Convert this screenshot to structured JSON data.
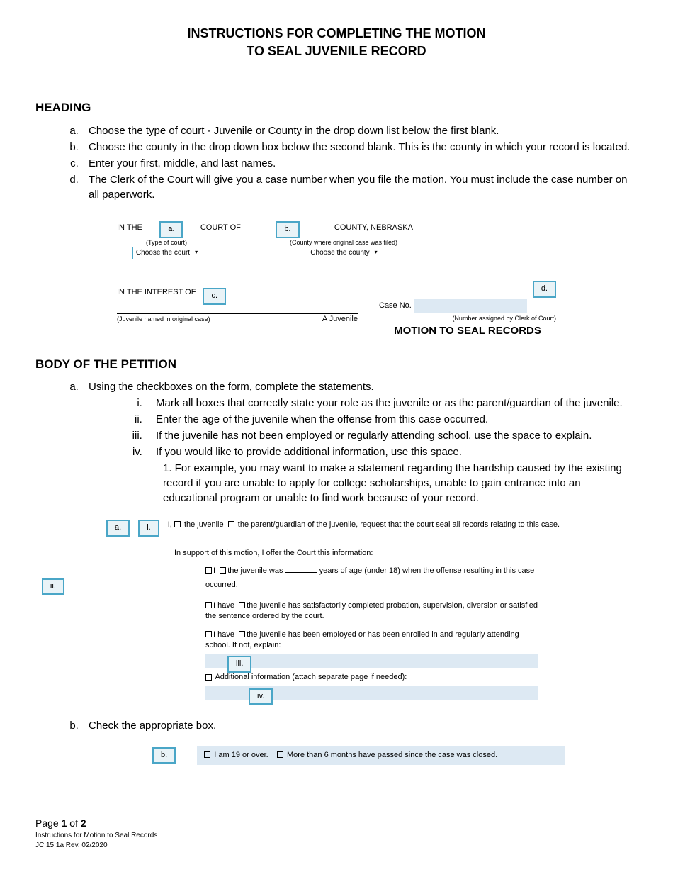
{
  "title_line1": "INSTRUCTIONS FOR COMPLETING THE MOTION",
  "title_line2": "TO SEAL JUVENILE RECORD",
  "heading_section": "HEADING",
  "heading_items": {
    "a": "Choose the type of court - Juvenile or County in the drop down list below the first blank.",
    "b": "Choose the county in the drop down box below the second blank. This is the county in which your record is located.",
    "c": "Enter your first, middle, and last names.",
    "d": "The Clerk of the Court will give you a case number when you file the motion. You must include the case number on all paperwork."
  },
  "form1": {
    "in_the": "IN THE",
    "a": "a.",
    "court_of": "COURT OF",
    "b": "b.",
    "county_ne": "COUNTY, NEBRASKA",
    "type_of_court": "(Type of court)",
    "county_filed": "(County where original case was filed)",
    "choose_court": "Choose the court",
    "choose_county": "Choose the county",
    "in_interest": "IN THE INTEREST OF",
    "c": "c.",
    "juv_named": "(Juvenile named in original case)",
    "a_juvenile": "A Juvenile",
    "case_no": "Case No.",
    "d": "d.",
    "num_assigned": "(Number assigned by Clerk of Court)",
    "motion_title": "MOTION TO SEAL RECORDS"
  },
  "body_section": "BODY OF THE PETITION",
  "body_a": "Using the checkboxes on the form, complete the statements.",
  "body_items": {
    "i": "Mark all boxes that correctly state your role as the juvenile or as the parent/guardian of the juvenile.",
    "ii": "Enter the age of the juvenile when the offense from this case occurred.",
    "iii": "If the juvenile has not been employed or regularly attending school, use the space to explain.",
    "iv": "If you would like to provide additional information, use this space."
  },
  "body_example": "1.  For example, you may want to make a statement regarding the hardship caused by the existing record if you are unable to apply for college scholarships, unable to gain entrance into an educational program or unable to find work because of your record.",
  "form2": {
    "a": "a.",
    "i": "i.",
    "line1_pre": "I,",
    "opt_juv": "the juvenile",
    "opt_guard": "the parent/guardian of the juvenile",
    "line1_post": ", request that the court seal all records relating to this case.",
    "support": "In support of this motion, I offer the Court this information:",
    "line2a": "I",
    "line2b": "the juvenile was",
    "ii": "ii.",
    "line2c": "years of age (under 18) when the offense resulting in this case occurred.",
    "line3a": "I have",
    "line3b": "the juvenile has",
    "line3c": "satisfactorily completed probation, supervision, diversion or satisfied the sentence ordered by the court.",
    "line4a": "I have",
    "line4b": "the juvenile has",
    "line4c": "been employed or has been enrolled in and regularly attending school.  If not, explain:",
    "iii": "iii.",
    "addl": "Additional information (attach separate page if needed):",
    "iv": "iv."
  },
  "body_b": "Check the appropriate box.",
  "form3": {
    "b": "b.",
    "opt1": "I am 19 or over.",
    "opt2": "More than 6 months have passed since the case was closed."
  },
  "footer": {
    "page_pre": "Page ",
    "page_num": "1",
    "page_mid": " of ",
    "page_total": "2",
    "line2": "Instructions for Motion to Seal Records",
    "line3": "JC 15:1a Rev. 02/2020"
  }
}
